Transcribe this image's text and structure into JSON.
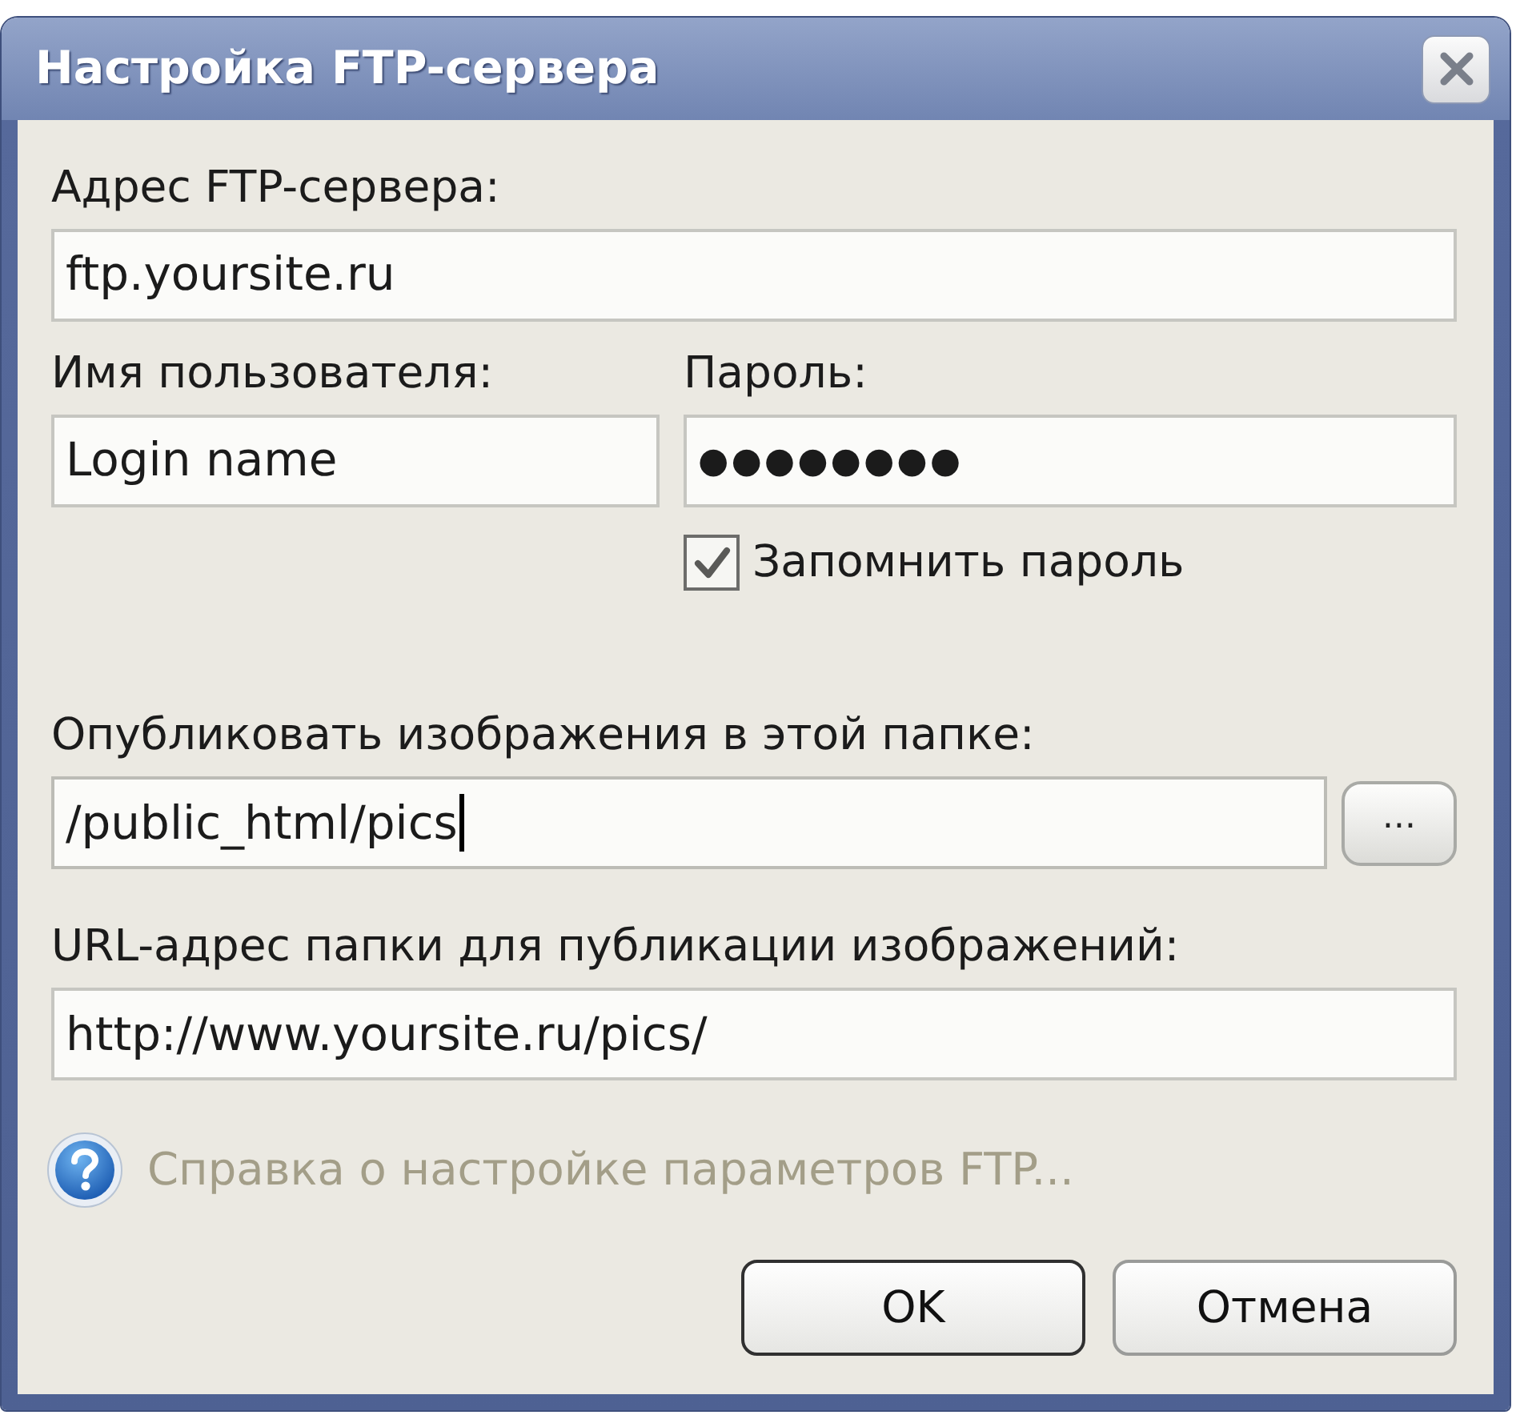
{
  "window": {
    "title": "Настройка FTP-сервера"
  },
  "server_address": {
    "label": "Адрес FTP-сервера:",
    "value": "ftp.yoursite.ru",
    "focused": false
  },
  "username": {
    "label": "Имя пользователя:",
    "value": "Login name",
    "focused": false
  },
  "password": {
    "label": "Пароль:",
    "value": "●●●●●●●●",
    "focused": false
  },
  "remember_password": {
    "label": "Запомнить пароль",
    "checked": true
  },
  "publish_folder": {
    "label": "Опубликовать изображения в этой папке:",
    "value": "/public_html/pics",
    "focused": true,
    "browse_button": "..."
  },
  "folder_url": {
    "label": "URL-адрес папки для публикации изображений:",
    "value": "http://www.yoursite.ru/pics/",
    "focused": false
  },
  "help_link": {
    "text": "Справка о настройке параметров FTP..."
  },
  "buttons": [
    {
      "label": "OK",
      "default": true
    },
    {
      "label": "Отмена",
      "default": false
    }
  ]
}
